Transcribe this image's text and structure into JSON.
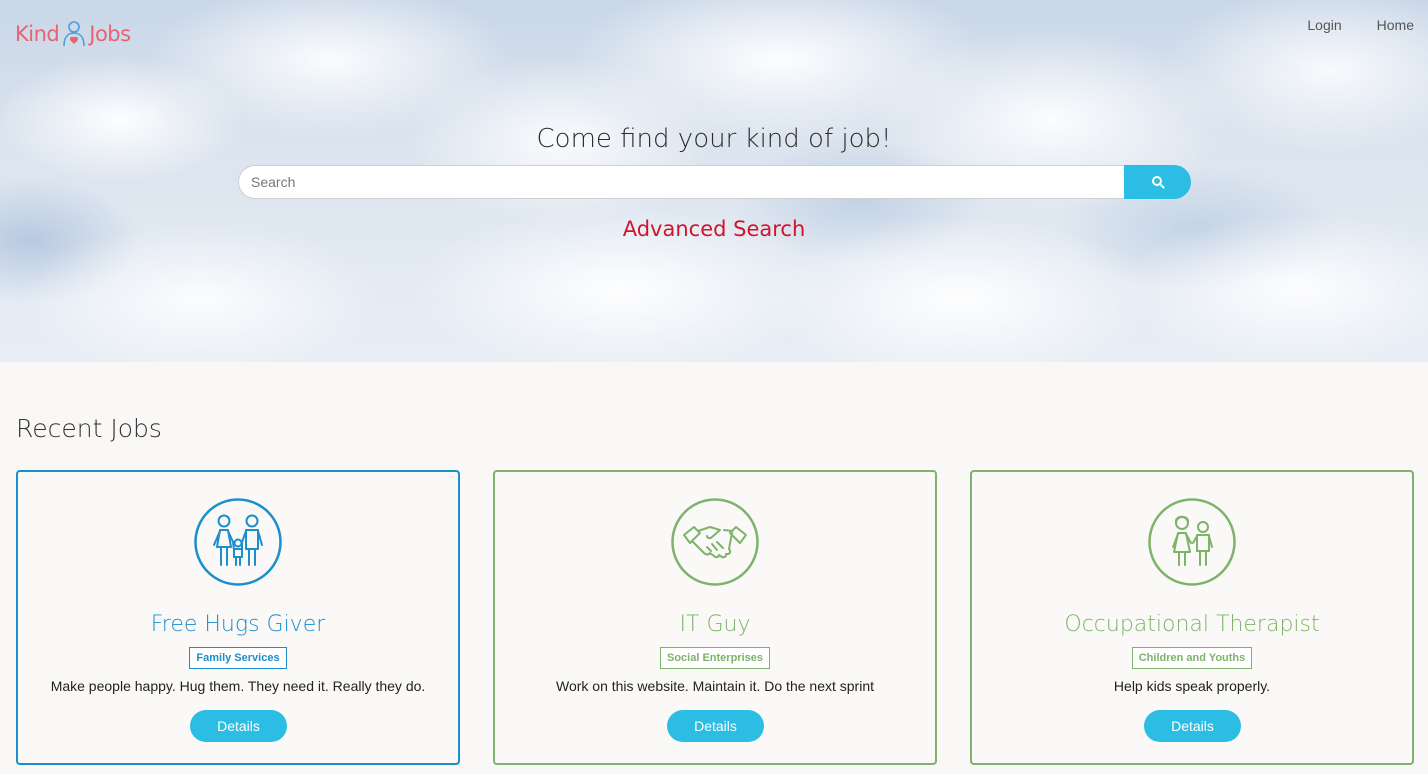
{
  "header": {
    "logo_left": "Kind",
    "logo_right": "Jobs",
    "nav": [
      {
        "label": "Login"
      },
      {
        "label": "Home"
      }
    ]
  },
  "hero": {
    "title": "Come find your kind of job!",
    "search": {
      "placeholder": "Search",
      "value": ""
    },
    "advanced_search_label": "Advanced Search"
  },
  "recent_jobs": {
    "title": "Recent Jobs",
    "cards": [
      {
        "icon": "family-icon",
        "title": "Free Hugs Giver",
        "category": "Family Services",
        "description": "Make people happy. Hug them. They need it. Really they do.",
        "button": "Details",
        "accent": "#1b8ecb"
      },
      {
        "icon": "handshake-icon",
        "title": "IT Guy",
        "category": "Social Enterprises",
        "description": "Work on this website. Maintain it. Do the next sprint",
        "button": "Details",
        "accent": "#7db36b"
      },
      {
        "icon": "children-icon",
        "title": "Occupational Therapist",
        "category": "Children and Youths",
        "description": "Help kids speak properly.",
        "button": "Details",
        "accent": "#7db36b"
      }
    ]
  },
  "colors": {
    "logo": "#e8636f",
    "button": "#2bbde3",
    "advanced_search": "#d0142a"
  }
}
